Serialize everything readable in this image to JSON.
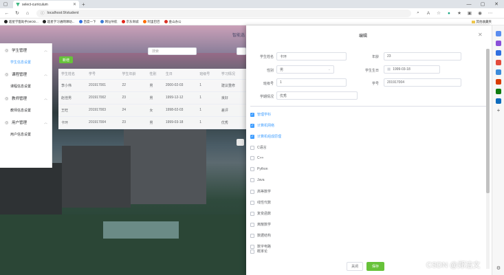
{
  "browser": {
    "tab_title": "select-curriculum",
    "url": "localhost:9/student",
    "bookmarks": [
      "超星学医助手(MOD...",
      "超星学习通网课助...",
      "百度一下",
      "网址导航",
      "京东商城",
      "阿里巴巴",
      "金山办公"
    ],
    "bookmarks_right": "其他收藏夹"
  },
  "header": {
    "title": "智能选"
  },
  "sidebar": {
    "groups": [
      {
        "label": "学生管理",
        "items": [
          {
            "label": "学生信息设置",
            "active": true
          }
        ]
      },
      {
        "label": "课程管理",
        "items": [
          {
            "label": "课程信息设置",
            "active": false
          }
        ]
      },
      {
        "label": "教师管理",
        "items": [
          {
            "label": "教师信息设置",
            "active": false
          }
        ]
      },
      {
        "label": "用户管理",
        "items": [
          {
            "label": "用户信息设置",
            "active": false
          }
        ]
      }
    ]
  },
  "toolbar": {
    "add_label": "新增",
    "search_placeholder": "搜索"
  },
  "table": {
    "columns": [
      "学生姓名",
      "学号",
      "学生年龄",
      "性别",
      "生日",
      "班级号",
      "学习情况"
    ],
    "rows": [
      [
        "李小伟",
        "201917001",
        "22",
        "男",
        "2000-02-03",
        "1",
        "建议重修"
      ],
      [
        "赵佳男",
        "201917002",
        "23",
        "男",
        "1999-12-12",
        "1",
        "良好"
      ],
      [
        "王旺",
        "201917003",
        "24",
        "女",
        "1998-02-03",
        "1",
        "差评"
      ],
      [
        "卡环",
        "201917004",
        "23",
        "男",
        "1999-03-18",
        "1",
        "优秀"
      ]
    ]
  },
  "drawer": {
    "title": "编辑",
    "fields": {
      "name_label": "学生姓名",
      "name_value": "卡环",
      "age_label": "年龄",
      "age_value": "23",
      "gender_label": "性别",
      "gender_value": "男",
      "birthday_label": "学生生日",
      "birthday_value": "1999-03-18",
      "class_label": "班级号",
      "class_value": "1",
      "sid_label": "学号",
      "sid_value": "201917004",
      "study_label": "学期情况",
      "study_value": "优秀"
    },
    "courses": [
      {
        "label": "管理学科",
        "checked": true
      },
      {
        "label": "计算机网络",
        "checked": true
      },
      {
        "label": "计算机组成原理",
        "checked": true
      },
      {
        "label": "C语言",
        "checked": false
      },
      {
        "label": "C++",
        "checked": false
      },
      {
        "label": "Python",
        "checked": false
      },
      {
        "label": "Java",
        "checked": false
      },
      {
        "label": "高等数学",
        "checked": false
      },
      {
        "label": "线性代数",
        "checked": false
      },
      {
        "label": "复变函数",
        "checked": false
      },
      {
        "label": "离散数学",
        "checked": false
      },
      {
        "label": "数据结构",
        "checked": false
      },
      {
        "label": "数字电路",
        "checked": false
      },
      {
        "label": "概率论",
        "checked": false
      }
    ],
    "cancel_label": "关闭",
    "save_label": "保存"
  },
  "watermark": "CSDN @郑洁文",
  "colors": {
    "primary": "#409eff",
    "success": "#67c23a"
  }
}
